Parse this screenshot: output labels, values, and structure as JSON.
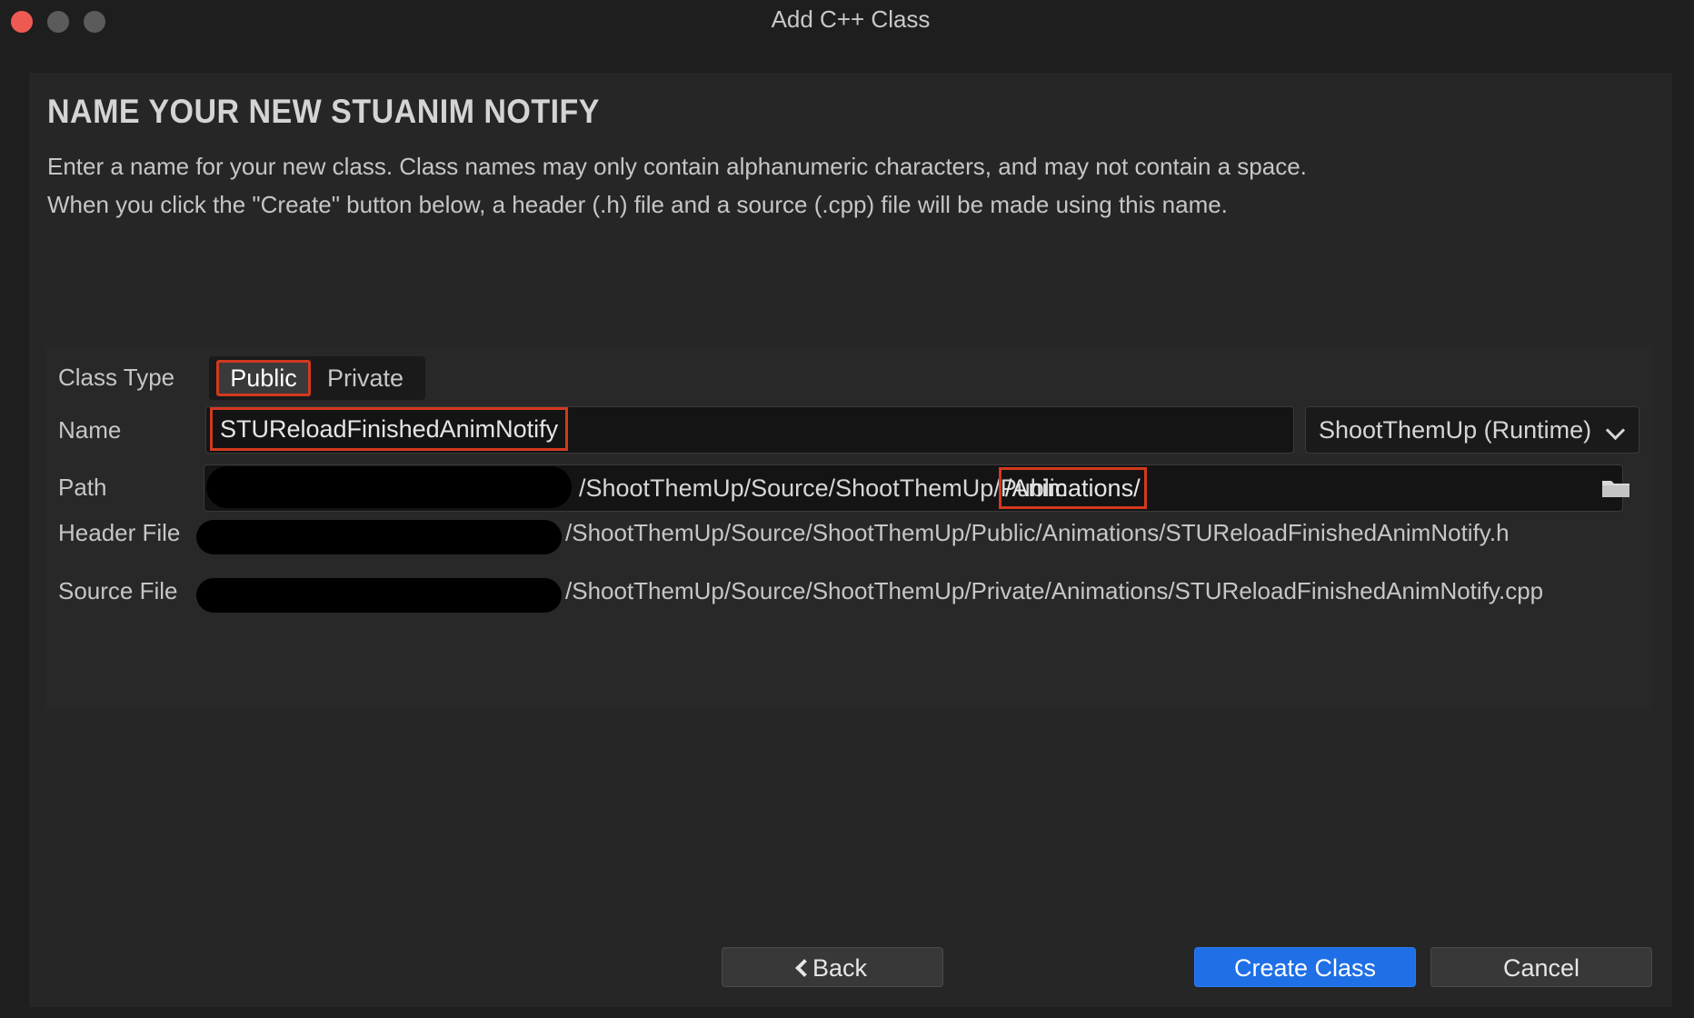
{
  "window": {
    "title": "Add C++ Class"
  },
  "header": {
    "heading": "NAME YOUR NEW STUANIM NOTIFY",
    "description_line1": "Enter a name for your new class. Class names may only contain alphanumeric characters, and may not contain a space.",
    "description_line2": "When you click the \"Create\" button below, a header (.h) file and a source (.cpp) file will be made using this name."
  },
  "form": {
    "class_type_label": "Class Type",
    "class_type_options": [
      "Public",
      "Private"
    ],
    "class_type_selected": "Public",
    "name_label": "Name",
    "name_value": "STUReloadFinishedAnimNotify",
    "module_value": "ShootThemUp (Runtime)",
    "path_label": "Path",
    "path_value": "/ShootThemUp/Source/ShootThemUp/Public",
    "path_highlight": "/Animations/",
    "header_file_label": "Header File",
    "header_file_value": "/ShootThemUp/Source/ShootThemUp/Public/Animations/STUReloadFinishedAnimNotify.h",
    "source_file_label": "Source File",
    "source_file_value": "/ShootThemUp/Source/ShootThemUp/Private/Animations/STUReloadFinishedAnimNotify.cpp"
  },
  "buttons": {
    "back": "Back",
    "create": "Create Class",
    "cancel": "Cancel"
  },
  "colors": {
    "accent": "#1f6fe6",
    "highlight_border": "#d2391f"
  }
}
